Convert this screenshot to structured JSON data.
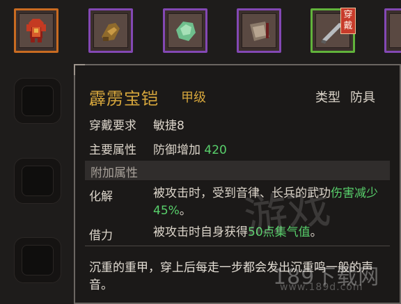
{
  "equipment_slots": [
    {
      "icon": "red-armor-icon",
      "border_color": "#c96b21"
    },
    {
      "icon": "bronze-gauntlet-icon",
      "border_color": "#8348b4"
    },
    {
      "icon": "jade-stone-icon",
      "border_color": "#8348b4"
    },
    {
      "icon": "scroll-pouch-icon",
      "border_color": "#8348b4"
    },
    {
      "icon": "blade-icon",
      "border_color": "#61b33b",
      "badge": "穿戴"
    }
  ],
  "tooltip": {
    "name": "霹雳宝铠",
    "grade": "甲级",
    "type_label": "类型",
    "type_value": "防具",
    "requirement_label": "穿戴要求",
    "requirement_value": "敏捷8",
    "main_attr_label": "主要属性",
    "main_attr_text": "防御增加",
    "main_attr_value": "420",
    "extra_section": "附加属性",
    "effects": [
      {
        "label": "化解",
        "text_before": "被攻击时，受到音律、长兵的武功",
        "highlight": "伤害减少45%",
        "text_after": "。"
      },
      {
        "label": "借力",
        "text_before": "被攻击时自身获得",
        "highlight": "50点集气值",
        "text_after": "。"
      }
    ],
    "description": "沉重的重甲，穿上后每走一步都会发出沉重鸣一般的声音。"
  },
  "watermark": {
    "site": "189下载网",
    "url": "www.189d.com"
  },
  "colors": {
    "name_gold": "#d6a63c",
    "highlight_green": "#58d06b",
    "panel_bg": "#1b1918"
  }
}
